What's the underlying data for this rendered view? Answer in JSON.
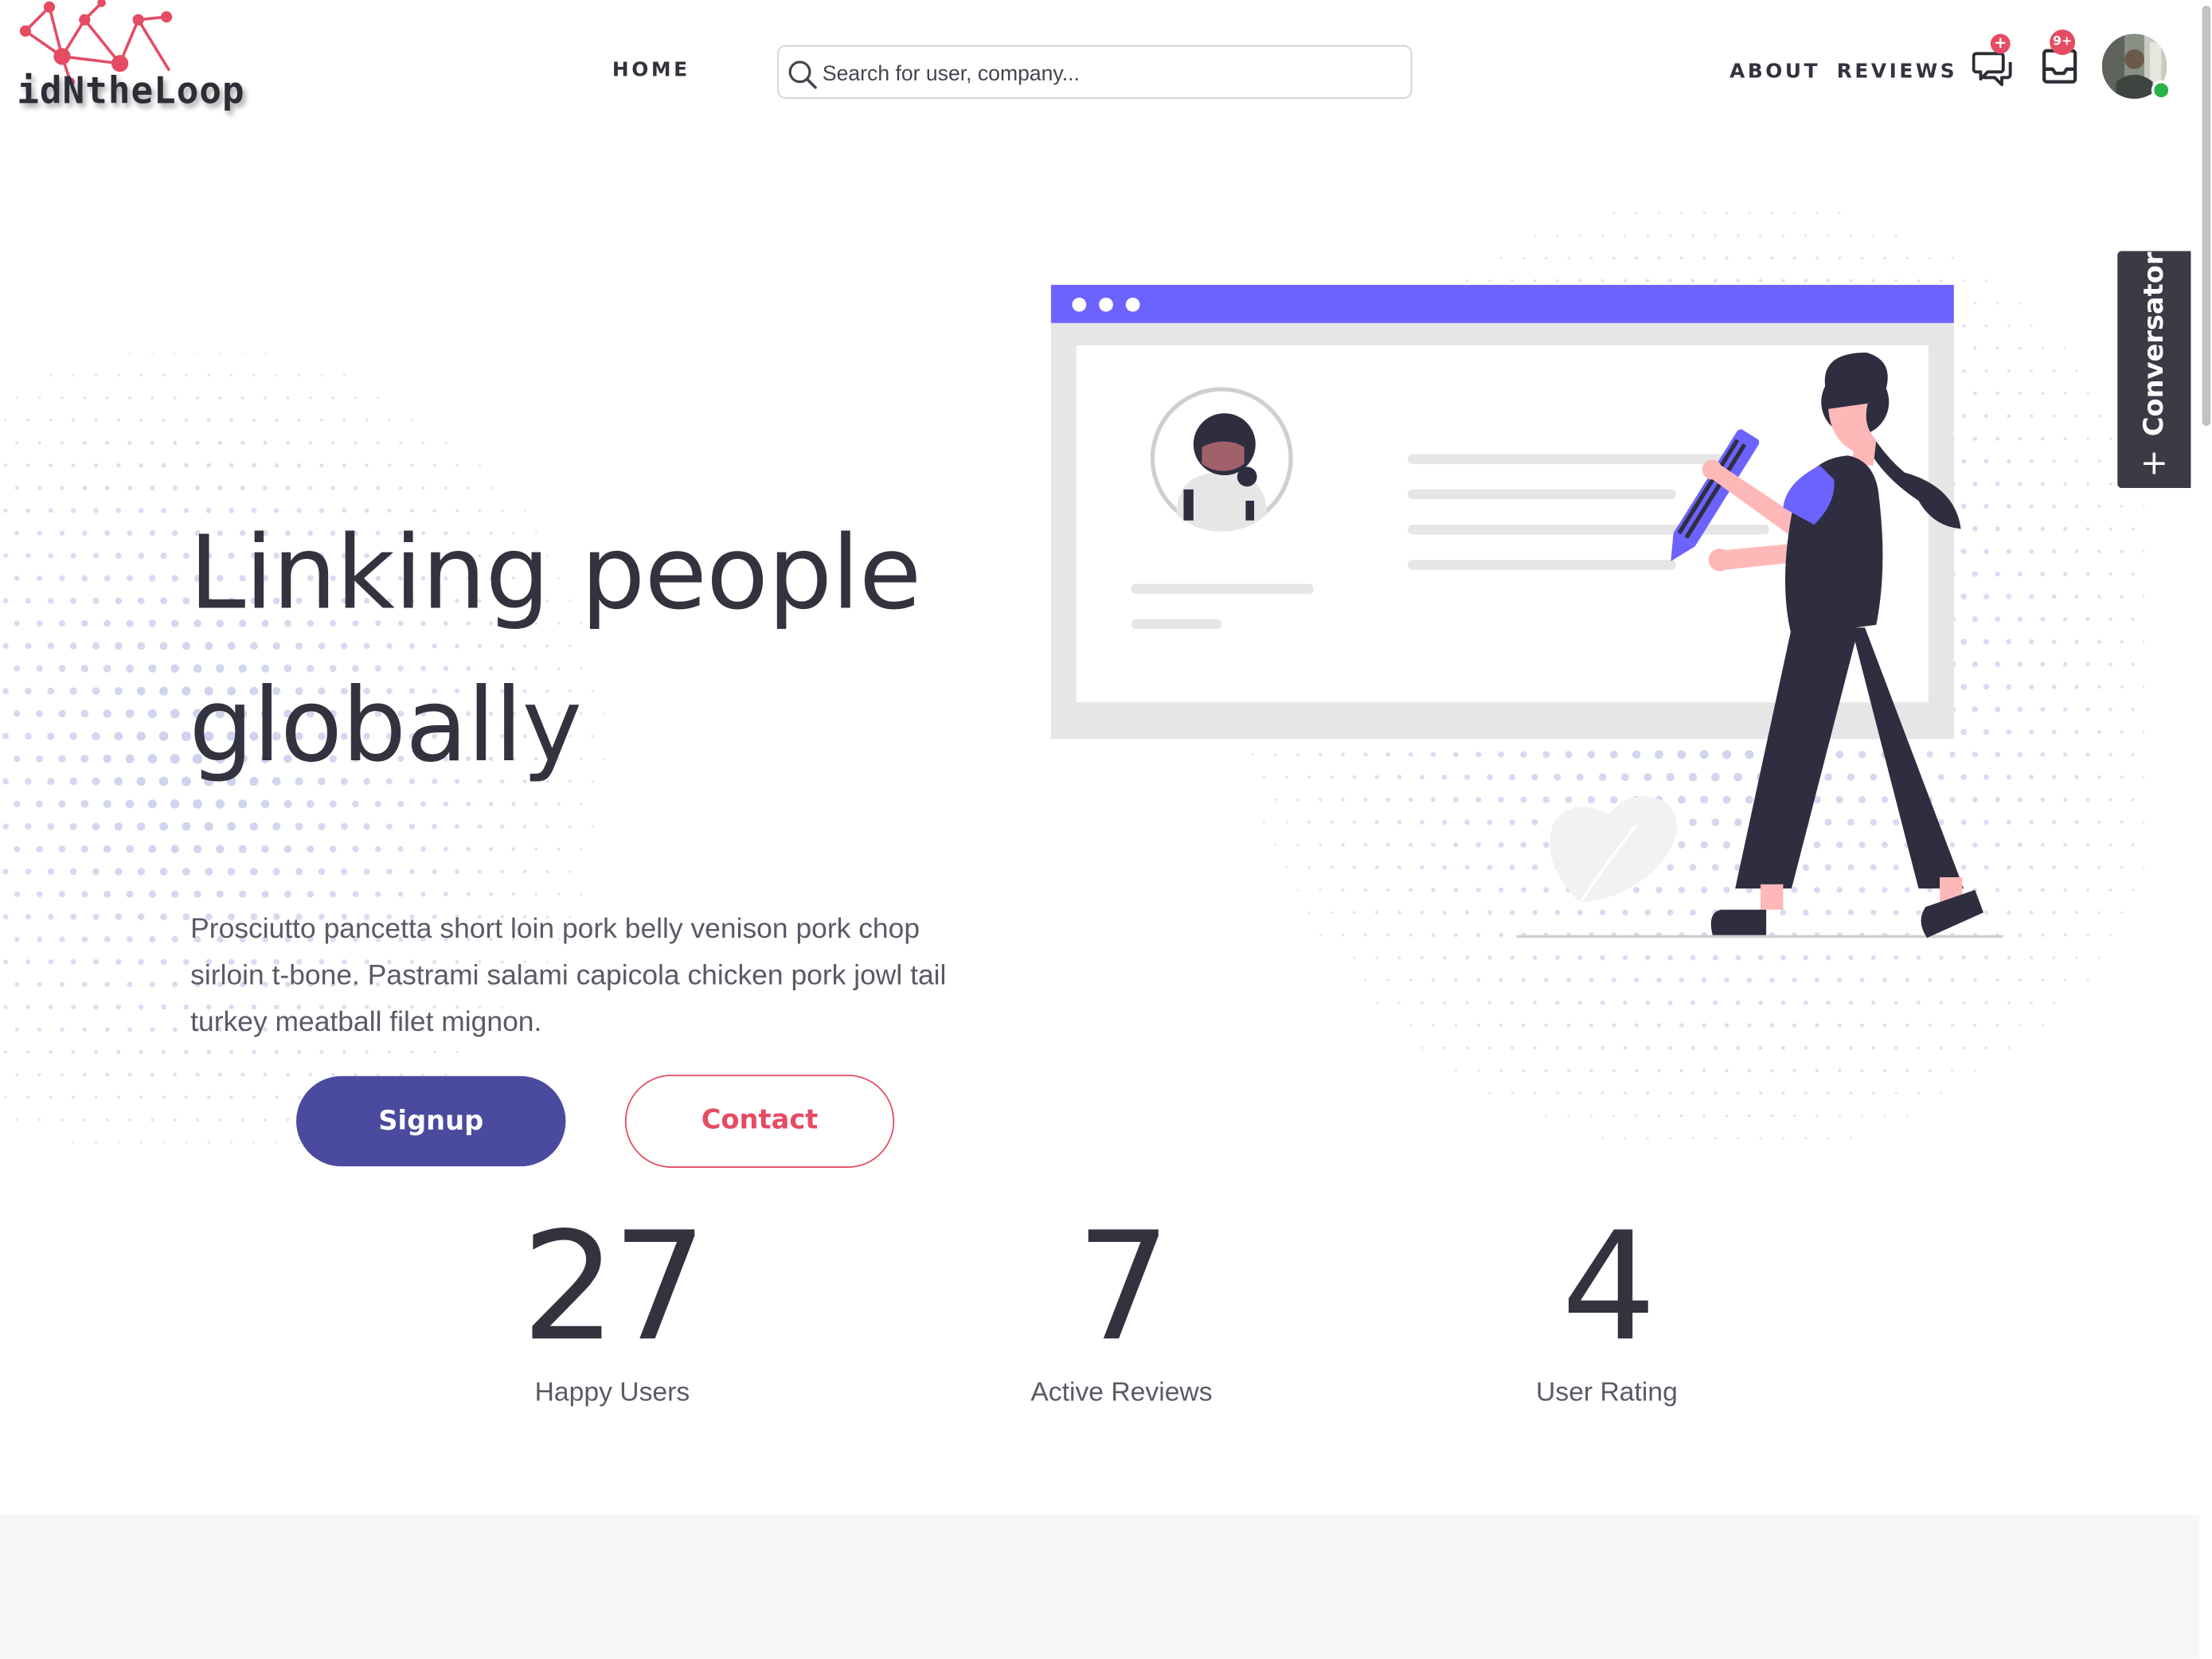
{
  "header": {
    "logo_text": "idNtheLoop",
    "nav": {
      "home": "HOME",
      "about": "ABOUT",
      "reviews": "REVIEWS"
    },
    "search": {
      "placeholder": "Search for user, company..."
    },
    "chat_badge": "+",
    "inbox_badge": "9+"
  },
  "hero": {
    "title_line1": "Linking people",
    "title_line2": "globally",
    "description": "Prosciutto pancetta short loin pork belly venison pork chop sirloin t-bone. Pastrami salami capicola chicken pork jowl tail turkey meatball filet mignon.",
    "signup_label": "Signup",
    "contact_label": "Contact"
  },
  "side_tab": {
    "label": "Conversator",
    "icon": "+"
  },
  "stats": [
    {
      "value": "27",
      "label": "Happy Users"
    },
    {
      "value": "7",
      "label": "Active Reviews"
    },
    {
      "value": "4",
      "label": "User Rating"
    }
  ],
  "colors": {
    "accent_pink": "#e54b63",
    "primary_indigo": "#4a4a9e",
    "illustration_purple": "#6c63ff",
    "text_dark": "#33333f",
    "dots": "#c5c9ea"
  },
  "icons": [
    "search-icon",
    "chat-icon",
    "inbox-icon",
    "plus-icon",
    "network-logo-icon"
  ]
}
